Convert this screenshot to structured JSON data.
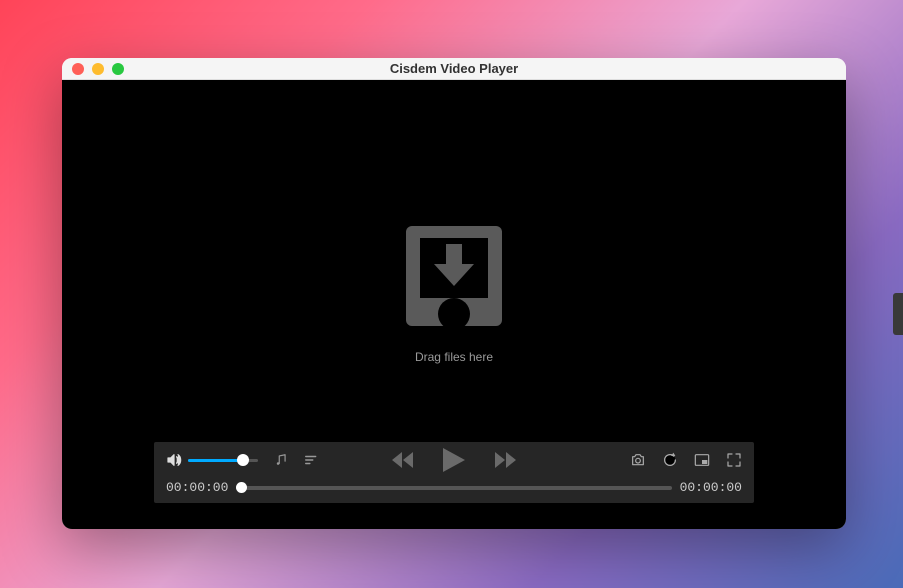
{
  "window": {
    "title": "Cisdem Video Player"
  },
  "dropzone": {
    "label": "Drag files here"
  },
  "controls": {
    "time_current": "00:00:00",
    "time_total": "00:00:00",
    "volume_percent": 80,
    "progress_percent": 0
  },
  "colors": {
    "accent": "#00aaff"
  }
}
